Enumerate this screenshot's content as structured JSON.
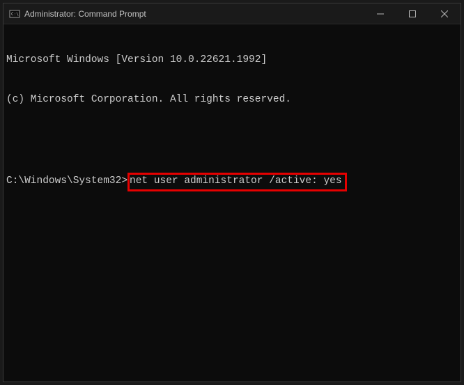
{
  "window": {
    "title": "Administrator: Command Prompt"
  },
  "terminal": {
    "line1": "Microsoft Windows [Version 10.0.22621.1992]",
    "line2": "(c) Microsoft Corporation. All rights reserved.",
    "prompt": "C:\\Windows\\System32>",
    "command": "net user administrator /active: yes"
  }
}
